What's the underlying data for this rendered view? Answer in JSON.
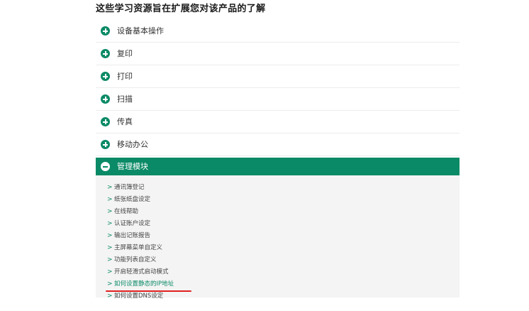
{
  "heading": "这些学习资源旨在扩展您对该产品的了解",
  "accent_color": "#0a8a66",
  "highlight_color": "#e02020",
  "sections": [
    {
      "label": "设备基本操作",
      "icon": "plus-circle-icon"
    },
    {
      "label": "复印",
      "icon": "plus-circle-icon"
    },
    {
      "label": "打印",
      "icon": "plus-circle-icon"
    },
    {
      "label": "扫描",
      "icon": "plus-circle-icon"
    },
    {
      "label": "传真",
      "icon": "plus-circle-icon"
    },
    {
      "label": "移动办公",
      "icon": "plus-circle-icon"
    }
  ],
  "open_section": {
    "label": "管理模块",
    "icon": "minus-circle-icon",
    "items": [
      {
        "label": "通讯簿登记"
      },
      {
        "label": "纸张纸盘设定"
      },
      {
        "label": "在线帮助"
      },
      {
        "label": "认证账户设定"
      },
      {
        "label": "输出记账报告"
      },
      {
        "label": "主屏幕菜单自定义"
      },
      {
        "label": "功能列表自定义"
      },
      {
        "label": "开启轻滑式启动模式"
      },
      {
        "label": "如何设置静态的IP地址"
      },
      {
        "label": "如何设置DNS设定"
      }
    ]
  },
  "chevron_glyph": ">"
}
